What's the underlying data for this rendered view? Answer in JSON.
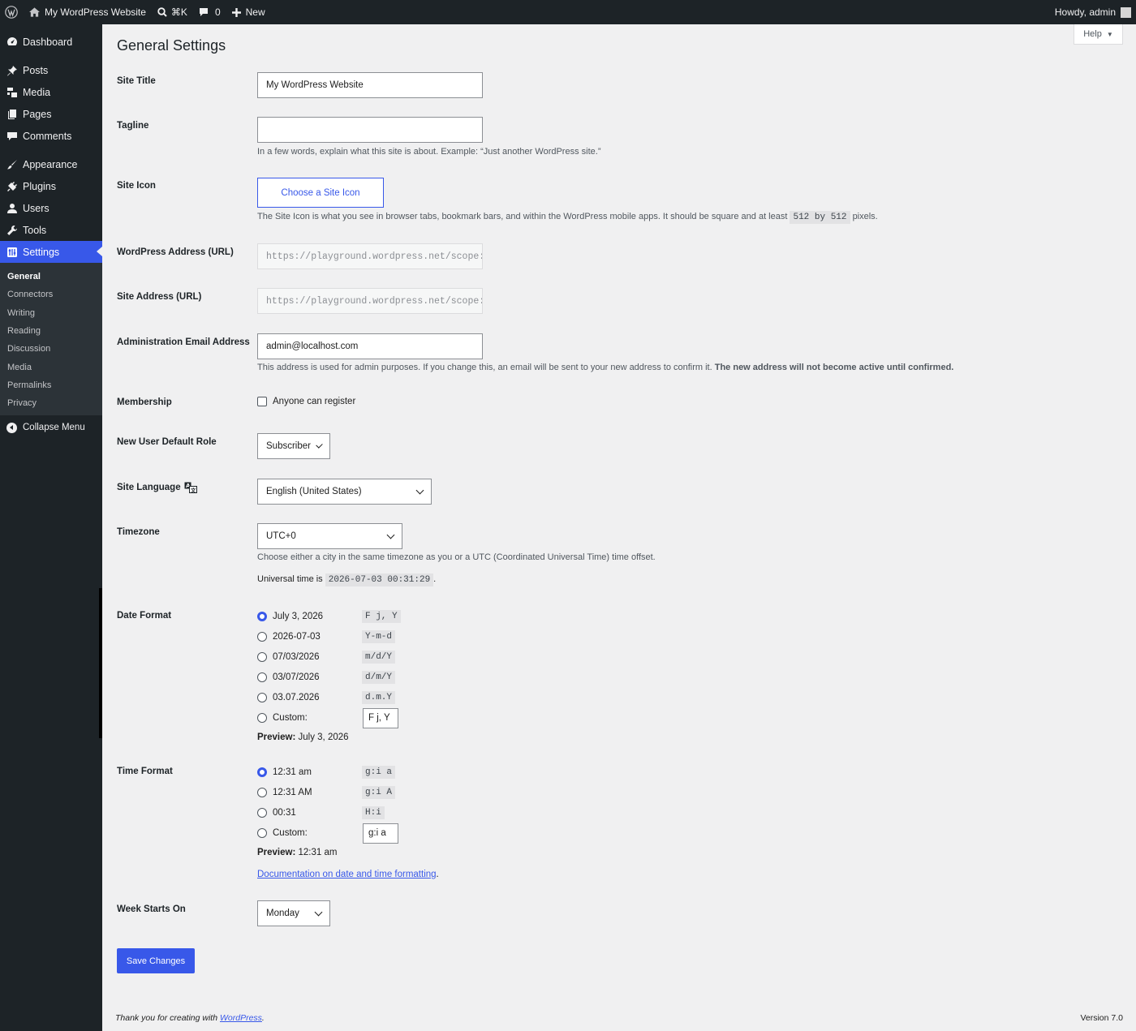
{
  "adminbar": {
    "site_name": "My WordPress Website",
    "search_shortcut": "⌘K",
    "comments_count": "0",
    "new_label": "New",
    "howdy": "Howdy, admin"
  },
  "sidebar": {
    "items": [
      {
        "label": "Dashboard"
      },
      {
        "label": "Posts"
      },
      {
        "label": "Media"
      },
      {
        "label": "Pages"
      },
      {
        "label": "Comments"
      },
      {
        "label": "Appearance"
      },
      {
        "label": "Plugins"
      },
      {
        "label": "Users"
      },
      {
        "label": "Tools"
      },
      {
        "label": "Settings"
      }
    ],
    "submenu": [
      "General",
      "Connectors",
      "Writing",
      "Reading",
      "Discussion",
      "Media",
      "Permalinks",
      "Privacy"
    ],
    "collapse": "Collapse Menu"
  },
  "page": {
    "title": "General Settings",
    "help": "Help"
  },
  "settings": {
    "site_title": {
      "label": "Site Title",
      "value": "My WordPress Website"
    },
    "tagline": {
      "label": "Tagline",
      "value": "",
      "desc": "In a few words, explain what this site is about. Example: “Just another WordPress site.”"
    },
    "site_icon": {
      "label": "Site Icon",
      "button": "Choose a Site Icon",
      "desc_pre": "The Site Icon is what you see in browser tabs, bookmark bars, and within the WordPress mobile apps. It should be square and at least",
      "desc_code": "512 by 512",
      "desc_post": "pixels."
    },
    "wp_address": {
      "label": "WordPress Address (URL)",
      "value": "https://playground.wordpress.net/scope:"
    },
    "site_address": {
      "label": "Site Address (URL)",
      "value": "https://playground.wordpress.net/scope:"
    },
    "admin_email": {
      "label": "Administration Email Address",
      "value": "admin@localhost.com",
      "desc_pre": "This address is used for admin purposes. If you change this, an email will be sent to your new address to confirm it.",
      "desc_bold": "The new address will not become active until confirmed."
    },
    "membership": {
      "label": "Membership",
      "checkbox": "Anyone can register",
      "checked": false
    },
    "default_role": {
      "label": "New User Default Role",
      "value": "Subscriber"
    },
    "language": {
      "label": "Site Language",
      "value": "English (United States)"
    },
    "timezone": {
      "label": "Timezone",
      "value": "UTC+0",
      "desc": "Choose either a city in the same timezone as you or a UTC (Coordinated Universal Time) time offset.",
      "universal_pre": "Universal time is",
      "universal_code": "2026-07-03 00:31:29",
      "universal_post": "."
    },
    "date_format": {
      "label": "Date Format",
      "options": [
        {
          "label": "July 3, 2026",
          "format": "F j, Y",
          "checked": true
        },
        {
          "label": "2026-07-03",
          "format": "Y-m-d",
          "checked": false
        },
        {
          "label": "07/03/2026",
          "format": "m/d/Y",
          "checked": false
        },
        {
          "label": "03/07/2026",
          "format": "d/m/Y",
          "checked": false
        },
        {
          "label": "03.07.2026",
          "format": "d.m.Y",
          "checked": false
        }
      ],
      "custom_label": "Custom:",
      "custom_value": "F j, Y",
      "preview_label": "Preview:",
      "preview_value": "July 3, 2026"
    },
    "time_format": {
      "label": "Time Format",
      "options": [
        {
          "label": "12:31 am",
          "format": "g:i a",
          "checked": true
        },
        {
          "label": "12:31 AM",
          "format": "g:i A",
          "checked": false
        },
        {
          "label": "00:31",
          "format": "H:i",
          "checked": false
        }
      ],
      "custom_label": "Custom:",
      "custom_value": "g:i a",
      "preview_label": "Preview:",
      "preview_value": "12:31 am",
      "doc_link": "Documentation on date and time formatting"
    },
    "week_starts": {
      "label": "Week Starts On",
      "value": "Monday"
    }
  },
  "save_button": "Save Changes",
  "footer": {
    "thanks_pre": "Thank you for creating with",
    "thanks_link": "WordPress",
    "version": "Version 7.0"
  },
  "colors": {
    "accent": "#3858e9",
    "sidebar_bg": "#1d2327",
    "page_bg": "#f0f0f1"
  }
}
